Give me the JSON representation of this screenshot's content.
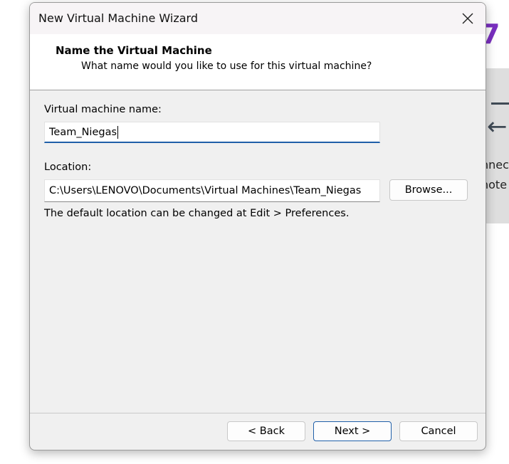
{
  "background": {
    "partial_numeral": "7",
    "partial_text_line1": "nnec",
    "partial_text_line2": "note"
  },
  "dialog": {
    "title": "New Virtual Machine Wizard",
    "close_icon": "close-icon",
    "header": {
      "title": "Name the Virtual Machine",
      "subtitle": "What name would you like to use for this virtual machine?"
    },
    "name_field": {
      "label": "Virtual machine name:",
      "value": "Team_Niegas"
    },
    "location_field": {
      "label": "Location:",
      "value": "C:\\Users\\LENOVO\\Documents\\Virtual Machines\\Team_Niegas",
      "browse_label": "Browse..."
    },
    "hint": "The default location can be changed at Edit > Preferences.",
    "buttons": {
      "back": "< Back",
      "next": "Next >",
      "cancel": "Cancel"
    }
  },
  "colors": {
    "accent": "#1f5fa8",
    "background_numeral": "#7a2fc0"
  }
}
